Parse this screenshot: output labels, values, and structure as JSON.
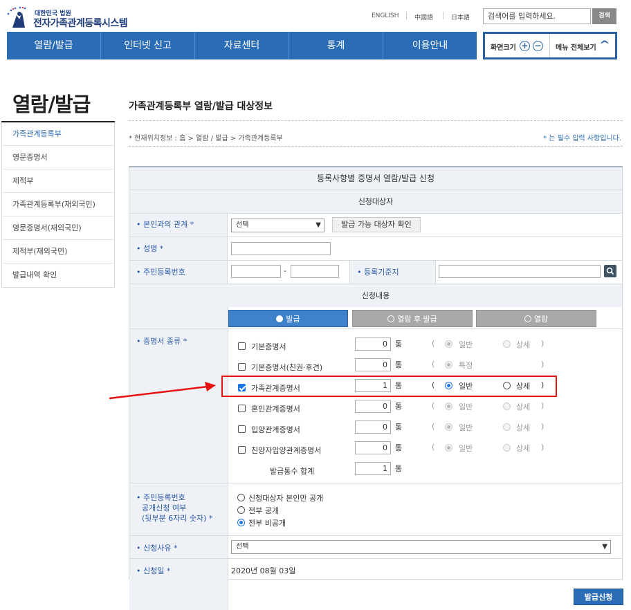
{
  "header": {
    "logo_small": "대한민국 법원",
    "logo_big": "전자가족관계등록시스템",
    "languages": [
      "ENGLISH",
      "中國語",
      "日本語"
    ],
    "search_placeholder": "검색어를 입력하세요.",
    "search_button": "검색"
  },
  "gnb": [
    "열람/발급",
    "인터넷 신고",
    "자료센터",
    "통계",
    "이용안내"
  ],
  "tools": {
    "zoom_label": "화면크기",
    "zoom_in": "+",
    "zoom_out": "−",
    "menu_all": "메뉴 전체보기"
  },
  "sidebar": {
    "title": "열람/발급",
    "items": [
      {
        "label": "가족관계등록부",
        "active": true
      },
      {
        "label": "영문증명서"
      },
      {
        "label": "제적부"
      },
      {
        "label": "가족관계등록부(재외국민)"
      },
      {
        "label": "영문증명서(재외국민)"
      },
      {
        "label": "제적부(재외국민)"
      },
      {
        "label": "발급내역 확인"
      }
    ]
  },
  "content": {
    "title": "가족관계등록부 열람/발급 대상정보",
    "location": "* 현재위치정보 : 홈 > 열람 / 발급 > 가족관계등록부",
    "required_note": "* 는 필수 입력 사항입니다."
  },
  "form": {
    "heading": "등록사항별 증명서 열람/발급 신청",
    "section_target": "신청대상자",
    "relation_label": "• 본인과의 관계 *",
    "relation_value": "선택",
    "relation_button": "발급 가능 대상자 확인",
    "name_label": "• 성명 *",
    "rrn_label": "• 주민등록번호",
    "rrn_sep": "-",
    "base_label": "• 등록기준지",
    "section_content": "신청내용",
    "tabs": [
      "발급",
      "열람 후 발급",
      "열람"
    ],
    "cert_label": "• 증명서 종류 *",
    "unit": "통",
    "paren_open": "(",
    "paren_close": ")",
    "certificates": [
      {
        "name": "기본증명서",
        "count": "0",
        "checked": false,
        "opt1": "일반",
        "opt2": "상세"
      },
      {
        "name": "기본증명서(친권·후견)",
        "count": "0",
        "checked": false,
        "opt1": "특정",
        "opt2": ""
      },
      {
        "name": "가족관계증명서",
        "count": "1",
        "checked": true,
        "opt1": "일반",
        "opt2": "상세"
      },
      {
        "name": "혼인관계증명서",
        "count": "0",
        "checked": false,
        "opt1": "일반",
        "opt2": "상세"
      },
      {
        "name": "입양관계증명서",
        "count": "0",
        "checked": false,
        "opt1": "일반",
        "opt2": "상세"
      },
      {
        "name": "친양자입양관계증명서",
        "count": "0",
        "checked": false,
        "opt1": "일반",
        "opt2": "상세"
      }
    ],
    "total_label": "발급통수 합계",
    "total_value": "1",
    "disclosure_label_1": "• 주민등록번호",
    "disclosure_label_2": "공개신청 여부",
    "disclosure_label_3": "(뒷부분 6자리 숫자) *",
    "disclosure_options": [
      "신청대상자 본인만 공개",
      "전부 공개",
      "전부 비공개"
    ],
    "disclosure_selected": 2,
    "reason_label": "• 신청사유 *",
    "reason_value": "선택",
    "date_label": "• 신청일 *",
    "date_value": "2020년 08월 03일"
  },
  "submit_button": "발급신청",
  "colors": {
    "primary": "#2b6cb6",
    "highlight": "#e61010",
    "label": "#2b5aa8"
  }
}
